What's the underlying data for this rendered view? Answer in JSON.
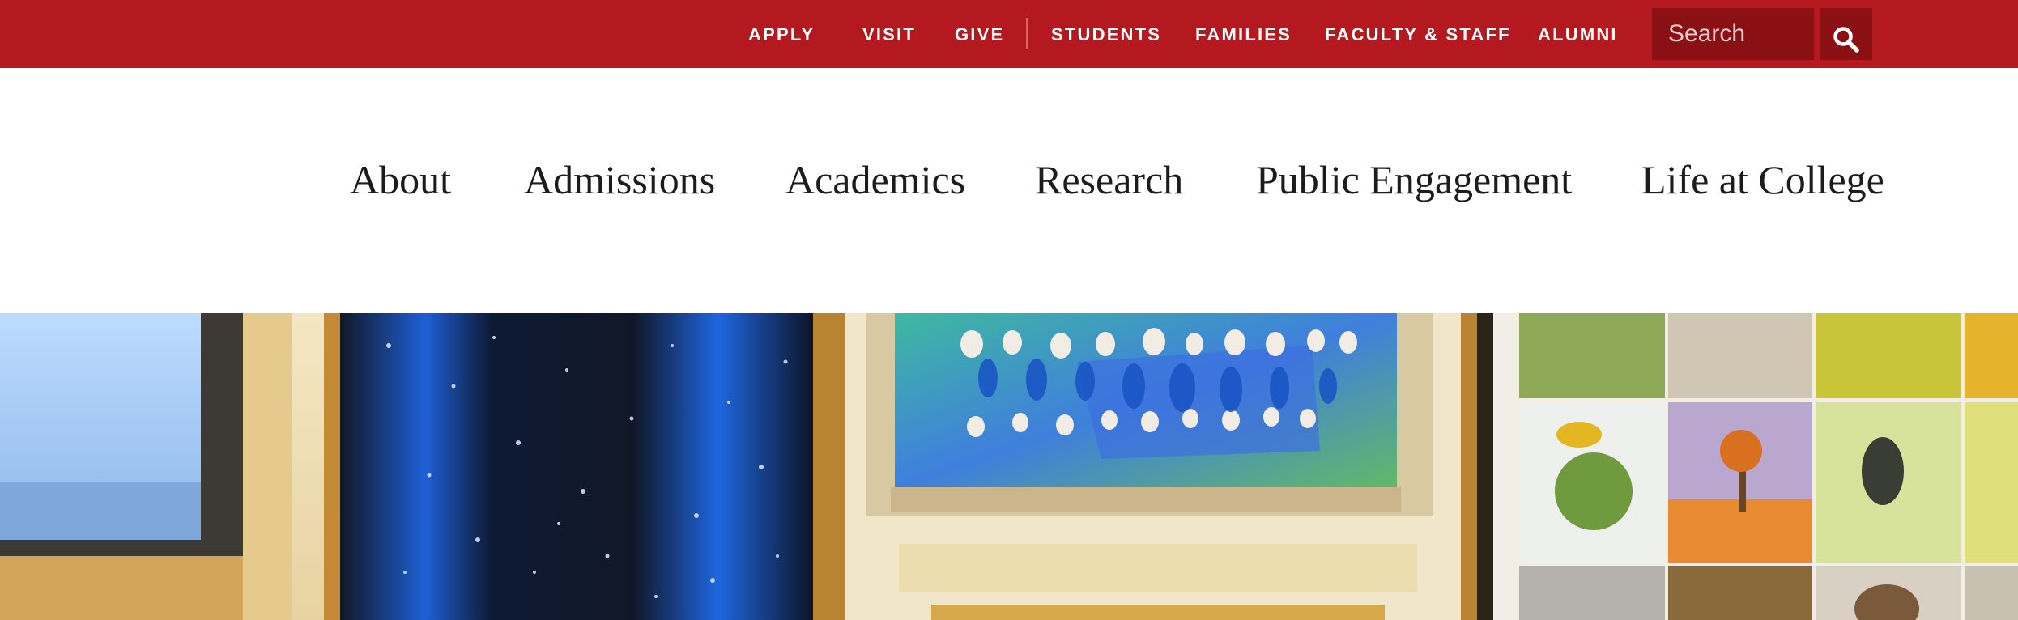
{
  "utility_nav": {
    "links": [
      {
        "label": "APPLY"
      },
      {
        "label": "VISIT"
      },
      {
        "label": "GIVE"
      },
      {
        "label": "STUDENTS"
      },
      {
        "label": "FAMILIES"
      },
      {
        "label": "FACULTY & STAFF"
      },
      {
        "label": "ALUMNI"
      }
    ],
    "search": {
      "placeholder": "Search",
      "button_icon": "search-icon"
    }
  },
  "main_nav": {
    "items": [
      {
        "label": "About"
      },
      {
        "label": "Admissions"
      },
      {
        "label": "Academics"
      },
      {
        "label": "Research"
      },
      {
        "label": "Public Engagement"
      },
      {
        "label": "Life at College"
      }
    ]
  },
  "colors": {
    "brand_red": "#b3191e",
    "search_bg": "#8a1014",
    "nav_text": "#1c1c1c"
  }
}
